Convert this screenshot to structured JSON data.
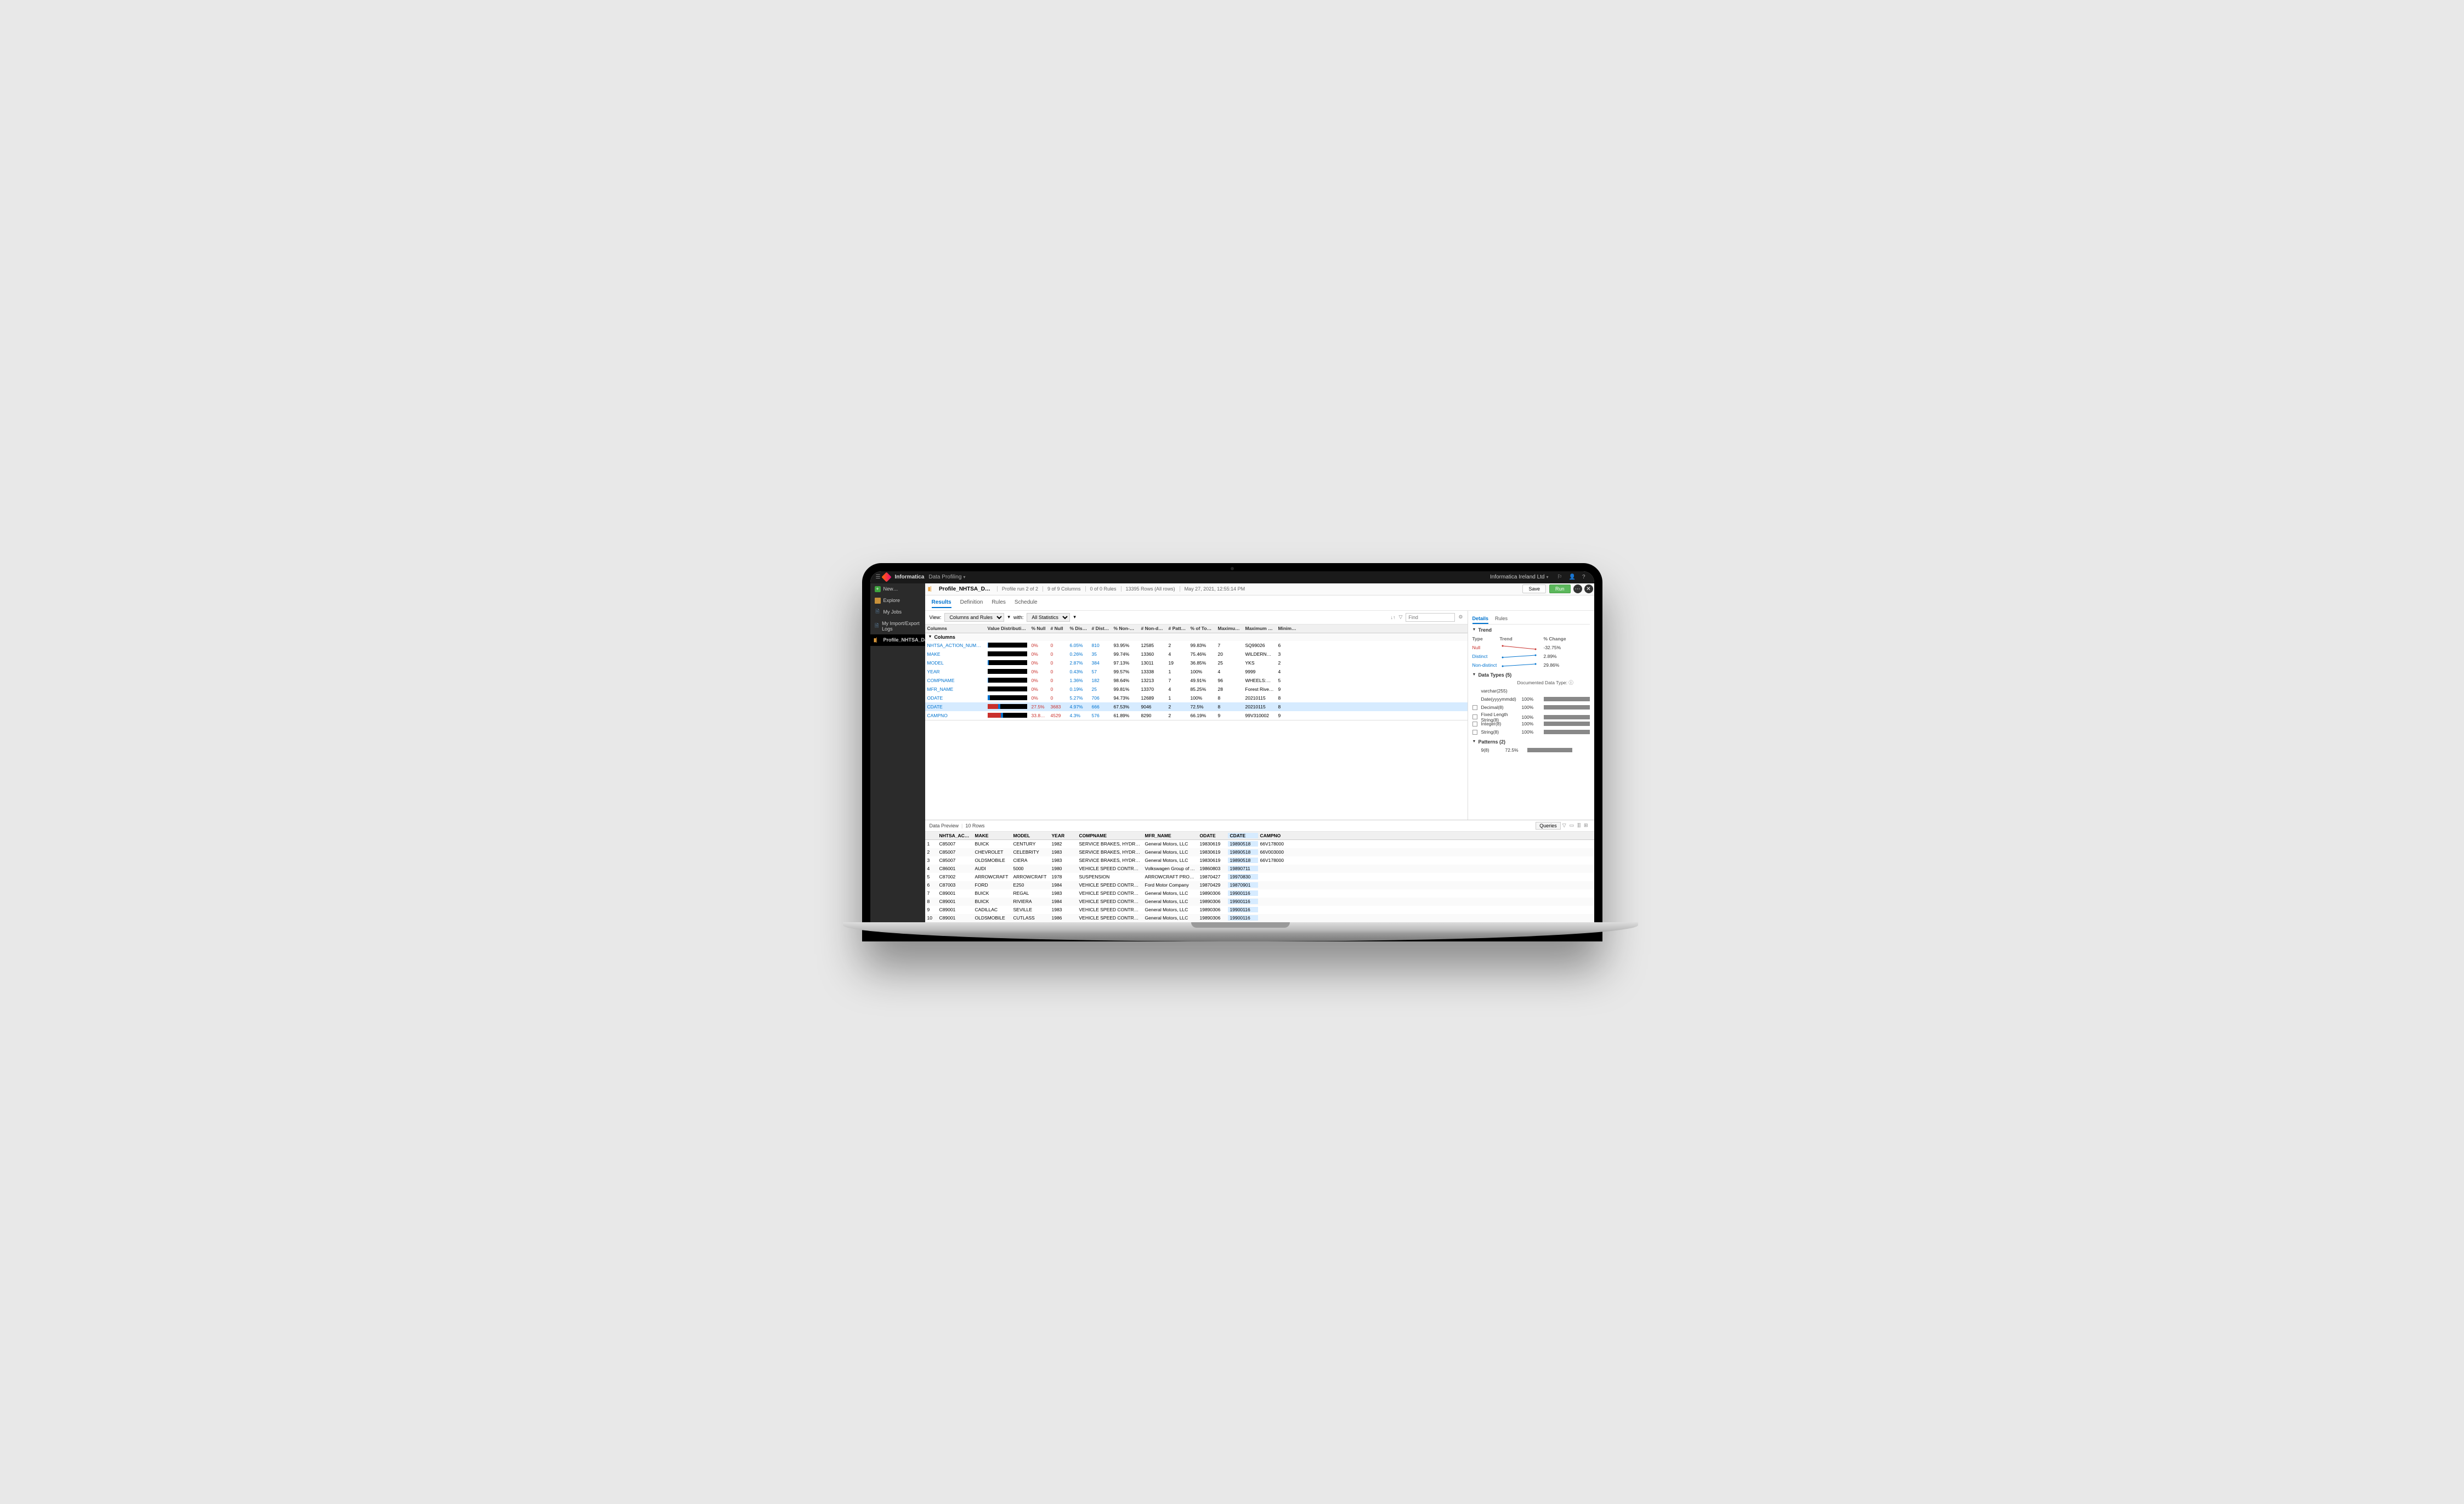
{
  "topbar": {
    "brand": "Informatica",
    "module": "Data Profiling",
    "org": "Informatica Ireland Ltd"
  },
  "sidebar": {
    "new": "New…",
    "explore": "Explore",
    "jobs": "My Jobs",
    "import": "My Import/Export Logs",
    "active": "Profile_NHTSA_Data"
  },
  "header": {
    "editor_title": "Profile_NHTSA_D…",
    "crumb1": "Profile run 2 of 2",
    "crumb2": "9 of 9 Columns",
    "crumb3": "0 of 0 Rules",
    "crumb4": "13395 Rows (All rows)",
    "crumb5": "May 27, 2021, 12:55:14 PM",
    "save": "Save",
    "run": "Run"
  },
  "subTabs": {
    "results": "Results",
    "definition": "Definition",
    "rules": "Rules",
    "schedule": "Schedule"
  },
  "viewBar": {
    "view": "View:",
    "mode": "Columns and Rules",
    "with": "with:",
    "stats": "All Statistics",
    "find": "Find"
  },
  "colsHeader": {
    "c1": "Columns",
    "c2": "Value Distribution",
    "c3": "% Null",
    "c4": "# Null",
    "c5": "% Distinct",
    "c6": "# Distinct",
    "c7": "% Non-dist…",
    "c8": "# Non-disti…",
    "c9": "# Patterns",
    "c10": "% of Top Pa…",
    "c11": "Maximum L…",
    "c12": "Maximum …",
    "c13": "Minimum Le…"
  },
  "colsGroup": "Columns",
  "cols": [
    {
      "name": "NHTSA_ACTION_NUMBER",
      "r": 0,
      "b": 2,
      "pn": "0%",
      "nn": "0",
      "pd": "6.05%",
      "nd": "810",
      "pnd": "93.95%",
      "nnd": "12585",
      "pat": "2",
      "top": "99.83%",
      "ml": "7",
      "max": "SQ99026",
      "mn": "6"
    },
    {
      "name": "MAKE",
      "r": 0,
      "b": 1,
      "pn": "0%",
      "nn": "0",
      "pd": "0.26%",
      "nd": "35",
      "pnd": "99.74%",
      "nnd": "13360",
      "pat": "4",
      "top": "75.46%",
      "ml": "20",
      "max": "WILDERNE…",
      "mn": "3"
    },
    {
      "name": "MODEL",
      "r": 0,
      "b": 3,
      "pn": "0%",
      "nn": "0",
      "pd": "2.87%",
      "nd": "384",
      "pnd": "97.13%",
      "nnd": "13011",
      "pat": "19",
      "top": "36.85%",
      "ml": "25",
      "max": "YKS",
      "mn": "2"
    },
    {
      "name": "YEAR",
      "r": 0,
      "b": 1,
      "pn": "0%",
      "nn": "0",
      "pd": "0.43%",
      "nd": "57",
      "pnd": "99.57%",
      "nnd": "13338",
      "pat": "1",
      "top": "100%",
      "ml": "4",
      "max": "9999",
      "mn": "4"
    },
    {
      "name": "COMPNAME",
      "r": 0,
      "b": 2,
      "pn": "0%",
      "nn": "0",
      "pd": "1.36%",
      "nd": "182",
      "pnd": "98.64%",
      "nnd": "13213",
      "pat": "7",
      "top": "49.91%",
      "ml": "96",
      "max": "WHEELS:RIM",
      "mn": "5"
    },
    {
      "name": "MFR_NAME",
      "r": 0,
      "b": 1,
      "pn": "0%",
      "nn": "0",
      "pd": "0.19%",
      "nd": "25",
      "pnd": "99.81%",
      "nnd": "13370",
      "pat": "4",
      "top": "85.25%",
      "ml": "28",
      "max": "Forest River…",
      "mn": "9"
    },
    {
      "name": "ODATE",
      "r": 0,
      "b": 6,
      "pn": "0%",
      "nn": "0",
      "pd": "5.27%",
      "nd": "706",
      "pnd": "94.73%",
      "nnd": "12689",
      "pat": "1",
      "top": "100%",
      "ml": "8",
      "max": "20210115",
      "mn": "8"
    },
    {
      "name": "CDATE",
      "r": 27,
      "b": 5,
      "pn": "27.5%",
      "nn": "3683",
      "pd": "4.97%",
      "nd": "666",
      "pnd": "67.53%",
      "nnd": "9046",
      "pat": "2",
      "top": "72.5%",
      "ml": "8",
      "max": "20210115",
      "mn": "8",
      "selected": true
    },
    {
      "name": "CAMPNO",
      "r": 34,
      "b": 5,
      "pn": "33.81%",
      "nn": "4529",
      "pd": "4.3%",
      "nd": "576",
      "pnd": "61.89%",
      "nnd": "8290",
      "pat": "2",
      "top": "66.19%",
      "ml": "9",
      "max": "99V310002",
      "mn": "9"
    }
  ],
  "right": {
    "tabs": {
      "details": "Details",
      "rules": "Rules"
    },
    "trend": {
      "title": "Trend",
      "hType": "Type",
      "hTrend": "Trend",
      "hChange": "% Change",
      "rows": [
        {
          "type": "Null",
          "change": "-32.75%",
          "kind": "null"
        },
        {
          "type": "Distinct",
          "change": "2.89%",
          "kind": "dist"
        },
        {
          "type": "Non-distinct",
          "change": "29.86%",
          "kind": "nd"
        }
      ]
    },
    "dataTypes": {
      "title": "Data Types (5)",
      "docLabel": "Documented Data Type:",
      "rows": [
        {
          "name": "varchar(255)",
          "pct": "",
          "doc": true
        },
        {
          "name": "Date(yyyymmdd)",
          "pct": "100%"
        },
        {
          "name": "Decimal(8)",
          "pct": "100%",
          "cb": true
        },
        {
          "name": "Fixed Length String(8)",
          "pct": "100%",
          "cb": true
        },
        {
          "name": "Integer(8)",
          "pct": "100%",
          "cb": true
        },
        {
          "name": "String(8)",
          "pct": "100%",
          "cb": true
        }
      ]
    },
    "patterns": {
      "title": "Patterns (2)",
      "rows": [
        {
          "name": "9(8)",
          "pct": "72.5%"
        },
        {
          "name": "",
          "pct": ""
        }
      ]
    }
  },
  "preview": {
    "title": "Data Preview",
    "sep": "|",
    "count": "10 Rows",
    "queries": "Queries",
    "headers": [
      "",
      "NHTSA_ACTION_NUMBER",
      "MAKE",
      "MODEL",
      "YEAR",
      "COMPNAME",
      "MFR_NAME",
      "ODATE",
      "CDATE",
      "CAMPNO"
    ],
    "rows": [
      [
        "1",
        "C85007",
        "BUICK",
        "CENTURY",
        "1982",
        "SERVICE BRAKES, HYDRAULIC",
        "General Motors, LLC",
        "19830619",
        "19890518",
        "66V178000"
      ],
      [
        "2",
        "C85007",
        "CHEVROLET",
        "CELEBRITY",
        "1983",
        "SERVICE BRAKES, HYDRAULIC",
        "General Motors, LLC",
        "19830619",
        "19890518",
        "66V003000"
      ],
      [
        "3",
        "C85007",
        "OLDSMOBILE",
        "CIERA",
        "1983",
        "SERVICE BRAKES, HYDRAULIC",
        "General Motors, LLC",
        "19830619",
        "19890518",
        "66V178000"
      ],
      [
        "4",
        "C86001",
        "AUDI",
        "5000",
        "1980",
        "VEHICLE SPEED CONTROL:LINKA…",
        "Volkswagen Group of America, Inc.",
        "19860803",
        "19890711",
        ""
      ],
      [
        "5",
        "C87002",
        "ARROWCRAFT",
        "ARROWCRAFT",
        "1978",
        "SUSPENSION",
        "ARROWCRAFT PRODUCTS",
        "19870427",
        "19970830",
        ""
      ],
      [
        "6",
        "C87003",
        "FORD",
        "E250",
        "1984",
        "VEHICLE SPEED CONTROL:LINKA…",
        "Ford Motor Company",
        "19870429",
        "19870901",
        ""
      ],
      [
        "7",
        "C89001",
        "BUICK",
        "REGAL",
        "1983",
        "VEHICLE SPEED CONTROL:LINKA…",
        "General Motors, LLC",
        "19890306",
        "19900116",
        ""
      ],
      [
        "8",
        "C89001",
        "BUICK",
        "RIVIERA",
        "1984",
        "VEHICLE SPEED CONTROL:LINKA…",
        "General Motors, LLC",
        "19890306",
        "19900116",
        ""
      ],
      [
        "9",
        "C89001",
        "CADILLAC",
        "SEVILLE",
        "1983",
        "VEHICLE SPEED CONTROL:LINKA…",
        "General Motors, LLC",
        "19890306",
        "19900116",
        ""
      ],
      [
        "10",
        "C89001",
        "OLDSMOBILE",
        "CUTLASS",
        "1986",
        "VEHICLE SPEED CONTROL:LINKA…",
        "General Motors, LLC",
        "19890306",
        "19900116",
        ""
      ]
    ]
  }
}
